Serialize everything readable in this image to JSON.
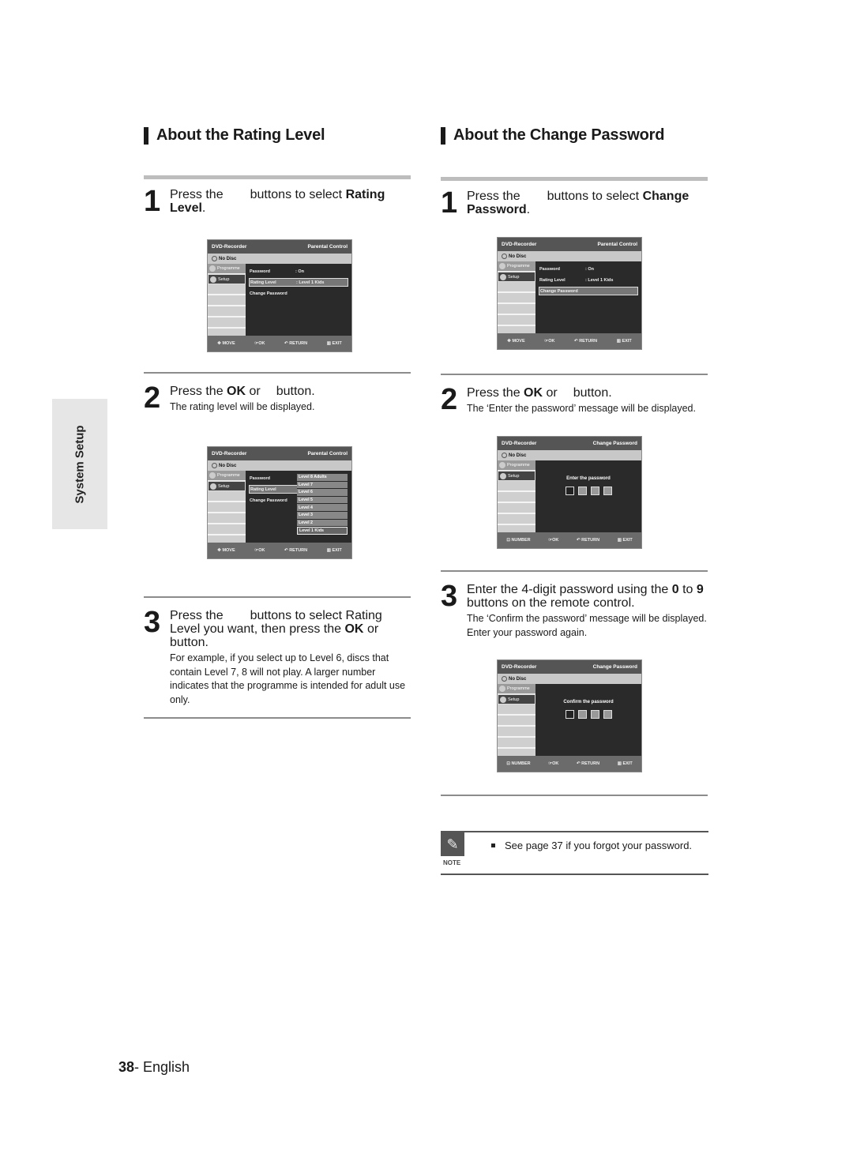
{
  "side_tab": {
    "label": "System Setup"
  },
  "left": {
    "title": "About the Rating Level",
    "step1": {
      "number": "1",
      "pre": "Press the",
      "mid": "buttons to select",
      "bold": "Rating",
      "line2_bold": "Level",
      "line2_end": "."
    },
    "step2": {
      "number": "2",
      "pre": "Press the",
      "bold": "OK",
      "post": "or",
      "end": "button.",
      "sub": "The rating level will be displayed."
    },
    "step3": {
      "number": "3",
      "pre": "Press the",
      "mid": "buttons to select Rating",
      "line2": "Level you want, then press the",
      "bold": "OK",
      "line2_end": "or",
      "line3": "button.",
      "sub": "For example, if you select up to Level 6, discs that contain Level 7, 8 will not play. A larger number indicates that the programme is intended for adult use only."
    }
  },
  "right": {
    "title": "About the Change Password",
    "step1": {
      "number": "1",
      "pre": "Press the",
      "mid": "buttons to select",
      "bold": "Change",
      "line2_bold": "Password",
      "line2_end": "."
    },
    "step2": {
      "number": "2",
      "pre": "Press the",
      "bold": "OK",
      "post": "or",
      "end": "button.",
      "sub": "The ‘Enter the password’ message will be displayed."
    },
    "step3": {
      "number": "3",
      "line1": "Enter the 4-digit password using the",
      "b1": "0",
      "to": "to",
      "b2": "9",
      "line2": "buttons on the remote control.",
      "sub1": "The ‘Confirm the password’ message will be displayed.",
      "sub2": "Enter your password again."
    }
  },
  "osd": {
    "brand": "DVD-Recorder",
    "disc": "No Disc",
    "menu_programme": "Programme",
    "menu_setup": "Setup",
    "parental_title": "Parental Control",
    "change_title": "Change Password",
    "password_label": "Password",
    "password_value": ": On",
    "rating_label": "Rating Level",
    "rating_value": ": Level 1 Kids",
    "change_label": "Change Password",
    "levels": [
      "Level 8 Adults",
      "Level 7",
      "Level 6",
      "Level 5",
      "Level 4",
      "Level 3",
      "Level 2",
      "Level 1 Kids"
    ],
    "enter_msg": "Enter the password",
    "confirm_msg": "Confirm the password",
    "foot_move": "MOVE",
    "foot_number": "NUMBER",
    "foot_ok": "OK",
    "foot_return": "RETURN",
    "foot_exit": "EXIT"
  },
  "note": {
    "label": "NOTE",
    "text": "See page 37 if you forgot your password."
  },
  "footer": {
    "page_number": "38",
    "language": "- English"
  }
}
